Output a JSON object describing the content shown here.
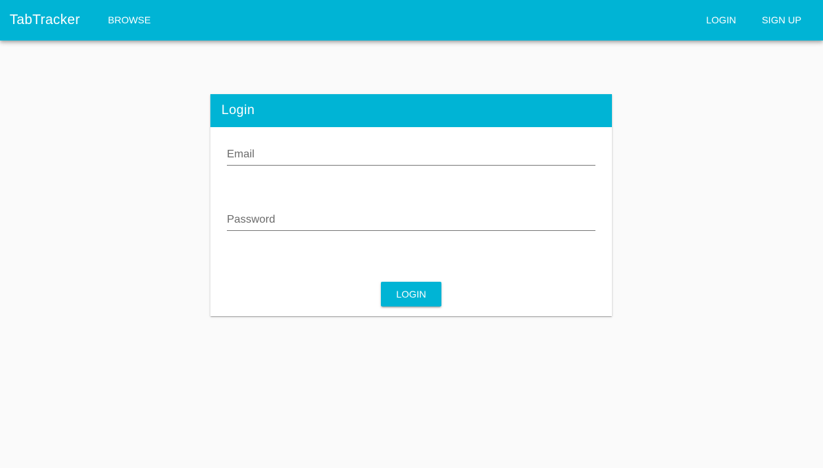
{
  "toolbar": {
    "title": "TabTracker",
    "browse_label": "BROWSE",
    "login_label": "LOGIN",
    "signup_label": "SIGN UP",
    "color": "#00b4d5"
  },
  "login_panel": {
    "title": "Login",
    "email_placeholder": "Email",
    "email_value": "",
    "password_placeholder": "Password",
    "password_value": "",
    "submit_label": "LOGIN"
  }
}
